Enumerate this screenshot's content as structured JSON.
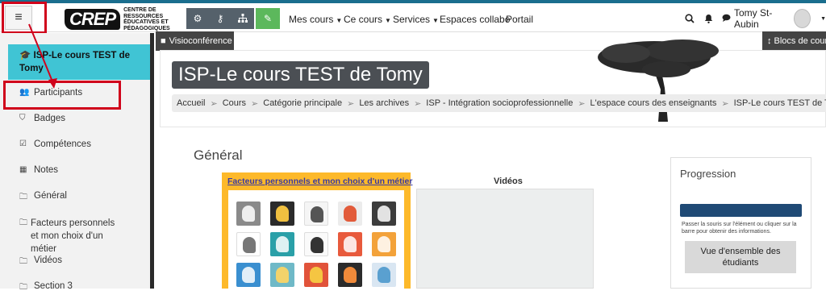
{
  "navbar": {
    "logo_mark": "CREP",
    "logo_text": "Centre de ressources éducatives et pédagogiques",
    "menu": [
      {
        "label": "Mes cours",
        "dropdown": true
      },
      {
        "label": "Ce cours",
        "dropdown": true
      },
      {
        "label": "Services",
        "dropdown": true
      },
      {
        "label": "Espaces collabo",
        "dropdown": false
      },
      {
        "label": "Portail",
        "dropdown": false
      }
    ],
    "user_name": "Tomy St-Aubin",
    "icons": [
      "hamburger-icon",
      "cogs-icon",
      "key-icon",
      "sitemap-icon",
      "edit-icon",
      "search-icon",
      "bell-icon",
      "chat-icon"
    ]
  },
  "sidebar": {
    "active_course": "ISP-Le cours TEST de Tomy",
    "items": [
      {
        "label": "Participants",
        "icon": "users-icon"
      },
      {
        "label": "Badges",
        "icon": "shield-icon"
      },
      {
        "label": "Compétences",
        "icon": "checkbox-icon"
      },
      {
        "label": "Notes",
        "icon": "table-icon"
      },
      {
        "label": "Général",
        "icon": "folder-icon"
      },
      {
        "label": "Facteurs personnels et mon choix d'un métier",
        "icon": "folder-icon"
      },
      {
        "label": "Vidéos",
        "icon": "folder-icon"
      },
      {
        "label": "Section 3",
        "icon": "folder-icon"
      }
    ]
  },
  "main": {
    "visio_label": "Visioconférence",
    "blocks_label": "Blocs de cours",
    "course_title": "ISP-Le cours TEST de Tomy",
    "breadcrumb": [
      "Accueil",
      "Cours",
      "Catégorie principale",
      "Les archives",
      "ISP - Intégration socioprofessionnelle",
      "L'espace cours des enseignants",
      "ISP-Le cours TEST de Tomy"
    ],
    "breadcrumb_sep": "➢",
    "section_title": "Général",
    "card_title": "Facteurs personnels et mon choix d'un métier",
    "videos_title": "Vidéos",
    "colors": {
      "accent": "#40c4d4",
      "card": "#fdb92a",
      "progress": "#1f4a75",
      "highlight": "#d0021b"
    }
  },
  "progress": {
    "title": "Progression",
    "note": "Passer la souris sur l'élément ou cliquer sur la barre pour obtenir des informations.",
    "overview_button": "Vue d'ensemble des étudiants"
  }
}
